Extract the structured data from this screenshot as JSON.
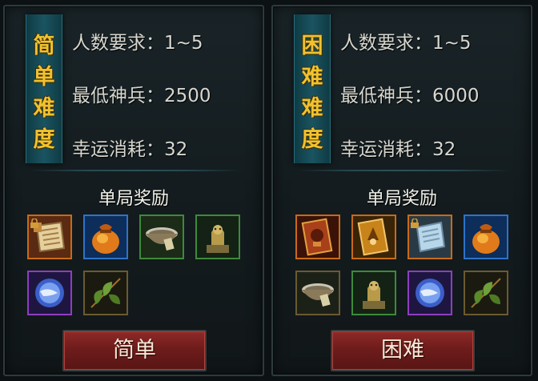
{
  "panels": [
    {
      "difficulty_chars": "简\n单\n难\n度",
      "players_label": "人数要求：1~5",
      "min_power_label": "最低神兵：2500",
      "luck_cost_label": "幸运消耗：32",
      "reward_title": "单局奖励",
      "button_label": "简单",
      "rewards": [
        {
          "icon": "scroll-icon",
          "rarity": "orange",
          "locked": true
        },
        {
          "icon": "coin-bag-icon",
          "rarity": "blue",
          "locked": false
        },
        {
          "icon": "bowl-icon",
          "rarity": "green",
          "locked": false
        },
        {
          "icon": "statue-icon",
          "rarity": "green",
          "locked": false
        },
        {
          "icon": "orb-icon",
          "rarity": "purple",
          "locked": false
        },
        {
          "icon": "leaf-icon",
          "rarity": "gold",
          "locked": false
        }
      ]
    },
    {
      "difficulty_chars": "困\n难\n难\n度",
      "players_label": "人数要求：1~5",
      "min_power_label": "最低神兵：6000",
      "luck_cost_label": "幸运消耗：32",
      "reward_title": "单局奖励",
      "button_label": "困难",
      "rewards": [
        {
          "icon": "card-red-icon",
          "rarity": "orange",
          "locked": false
        },
        {
          "icon": "card-gold-icon",
          "rarity": "orange",
          "locked": false
        },
        {
          "icon": "scroll-blue-icon",
          "rarity": "orange",
          "locked": true
        },
        {
          "icon": "coin-bag-icon",
          "rarity": "blue",
          "locked": false
        },
        {
          "icon": "bowl-icon",
          "rarity": "gold",
          "locked": false
        },
        {
          "icon": "statue-icon",
          "rarity": "green",
          "locked": false
        },
        {
          "icon": "orb-icon",
          "rarity": "purple",
          "locked": false
        },
        {
          "icon": "leaf-icon",
          "rarity": "gold",
          "locked": false
        }
      ]
    }
  ]
}
